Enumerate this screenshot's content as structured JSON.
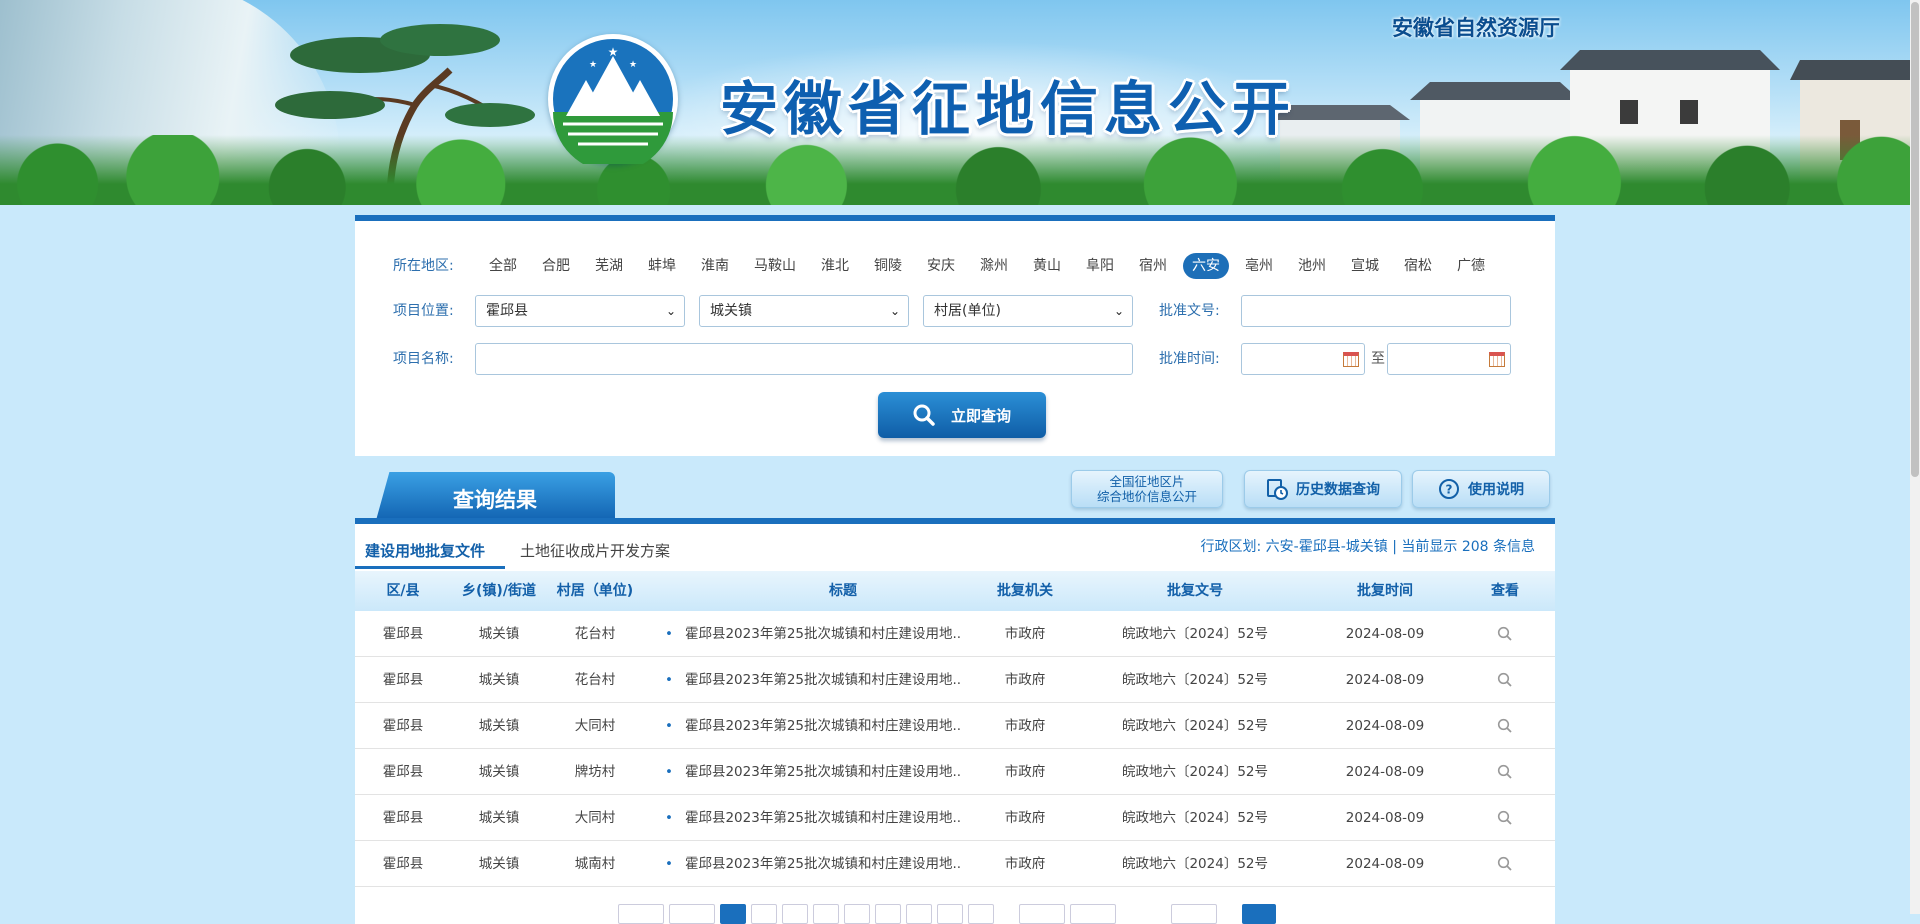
{
  "header": {
    "site_title": "安徽省征地信息公开",
    "org_name": "安徽省自然资源厅",
    "logo_icon": "mountain-emblem-icon"
  },
  "search": {
    "region_label": "所在地区:",
    "regions": [
      "全部",
      "合肥",
      "芜湖",
      "蚌埠",
      "淮南",
      "马鞍山",
      "淮北",
      "铜陵",
      "安庆",
      "滁州",
      "黄山",
      "阜阳",
      "宿州",
      "六安",
      "亳州",
      "池州",
      "宣城",
      "宿松",
      "广德"
    ],
    "active_region": "六安",
    "location_label": "项目位置:",
    "county_value": "霍邱县",
    "town_value": "城关镇",
    "village_value": "村居(单位)",
    "approval_no_label": "批准文号:",
    "approval_no_value": "",
    "project_name_label": "项目名称:",
    "project_name_value": "",
    "approval_time_label": "批准时间:",
    "date_from": "",
    "date_to": "",
    "date_sep": "至",
    "submit_label": "立即查询",
    "accent_color": "#1a6fbd"
  },
  "results": {
    "title": "查询结果",
    "national_btn_line1": "全国征地区片",
    "national_btn_line2": "综合地价信息公开",
    "history_btn": "历史数据查询",
    "help_btn": "使用说明",
    "subtabs": [
      "建设用地批复文件",
      "土地征收成片开发方案"
    ],
    "district_info": "行政区划: 六安-霍邱县-城关镇 | 当前显示 208 条信息",
    "columns": [
      "区/县",
      "乡(镇)/街道",
      "村居（单位)",
      "标题",
      "批复机关",
      "批复文号",
      "批复时间",
      "查看"
    ],
    "rows": [
      {
        "county": "霍邱县",
        "town": "城关镇",
        "village": "花台村",
        "title": "霍邱县2023年第25批次城镇和村庄建设用地..",
        "authority": "市政府",
        "doc_no": "皖政地六〔2024〕52号",
        "date": "2024-08-09"
      },
      {
        "county": "霍邱县",
        "town": "城关镇",
        "village": "花台村",
        "title": "霍邱县2023年第25批次城镇和村庄建设用地..",
        "authority": "市政府",
        "doc_no": "皖政地六〔2024〕52号",
        "date": "2024-08-09"
      },
      {
        "county": "霍邱县",
        "town": "城关镇",
        "village": "大同村",
        "title": "霍邱县2023年第25批次城镇和村庄建设用地..",
        "authority": "市政府",
        "doc_no": "皖政地六〔2024〕52号",
        "date": "2024-08-09"
      },
      {
        "county": "霍邱县",
        "town": "城关镇",
        "village": "牌坊村",
        "title": "霍邱县2023年第25批次城镇和村庄建设用地..",
        "authority": "市政府",
        "doc_no": "皖政地六〔2024〕52号",
        "date": "2024-08-09"
      },
      {
        "county": "霍邱县",
        "town": "城关镇",
        "village": "大同村",
        "title": "霍邱县2023年第25批次城镇和村庄建设用地..",
        "authority": "市政府",
        "doc_no": "皖政地六〔2024〕52号",
        "date": "2024-08-09"
      },
      {
        "county": "霍邱县",
        "town": "城关镇",
        "village": "城南村",
        "title": "霍邱县2023年第25批次城镇和村庄建设用地..",
        "authority": "市政府",
        "doc_no": "皖政地六〔2024〕52号",
        "date": "2024-08-09"
      }
    ]
  }
}
